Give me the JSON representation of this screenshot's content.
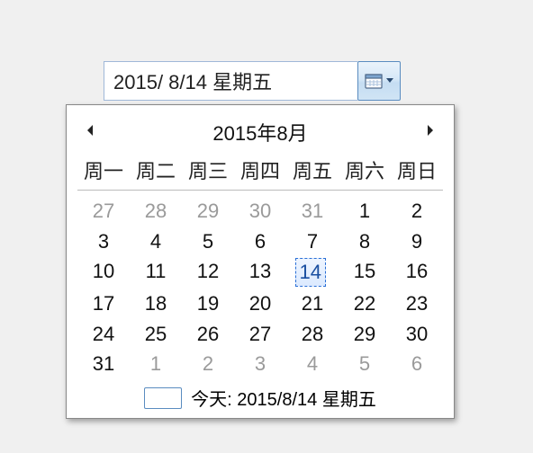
{
  "input": {
    "value": "2015/  8/14 星期五"
  },
  "calendar": {
    "title": "2015年8月",
    "weekdays": [
      "周一",
      "周二",
      "周三",
      "周四",
      "周五",
      "周六",
      "周日"
    ],
    "weeks": [
      [
        {
          "d": "27",
          "other": true
        },
        {
          "d": "28",
          "other": true
        },
        {
          "d": "29",
          "other": true
        },
        {
          "d": "30",
          "other": true
        },
        {
          "d": "31",
          "other": true
        },
        {
          "d": "1"
        },
        {
          "d": "2"
        }
      ],
      [
        {
          "d": "3"
        },
        {
          "d": "4"
        },
        {
          "d": "5"
        },
        {
          "d": "6"
        },
        {
          "d": "7"
        },
        {
          "d": "8"
        },
        {
          "d": "9"
        }
      ],
      [
        {
          "d": "10"
        },
        {
          "d": "11"
        },
        {
          "d": "12"
        },
        {
          "d": "13"
        },
        {
          "d": "14",
          "selected": true
        },
        {
          "d": "15"
        },
        {
          "d": "16"
        }
      ],
      [
        {
          "d": "17"
        },
        {
          "d": "18"
        },
        {
          "d": "19"
        },
        {
          "d": "20"
        },
        {
          "d": "21"
        },
        {
          "d": "22"
        },
        {
          "d": "23"
        }
      ],
      [
        {
          "d": "24"
        },
        {
          "d": "25"
        },
        {
          "d": "26"
        },
        {
          "d": "27"
        },
        {
          "d": "28"
        },
        {
          "d": "29"
        },
        {
          "d": "30"
        }
      ],
      [
        {
          "d": "31"
        },
        {
          "d": "1",
          "other": true
        },
        {
          "d": "2",
          "other": true
        },
        {
          "d": "3",
          "other": true
        },
        {
          "d": "4",
          "other": true
        },
        {
          "d": "5",
          "other": true
        },
        {
          "d": "6",
          "other": true
        }
      ]
    ],
    "today_label": "今天: 2015/8/14 星期五"
  }
}
